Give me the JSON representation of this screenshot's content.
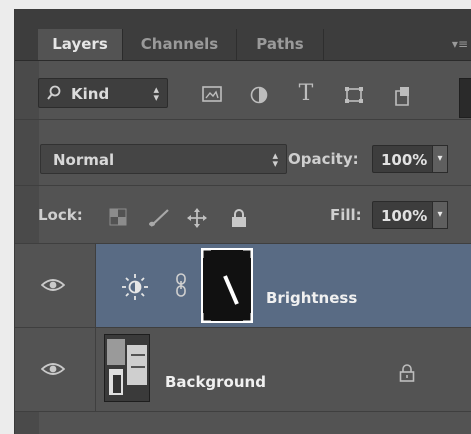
{
  "tabs": [
    {
      "label": "Layers",
      "active": true
    },
    {
      "label": "Channels",
      "active": false
    },
    {
      "label": "Paths",
      "active": false
    }
  ],
  "filter": {
    "kind_label": "Kind",
    "icons": [
      "image-filter-icon",
      "adjustment-filter-icon",
      "type-filter-icon",
      "shape-filter-icon",
      "smart-object-filter-icon"
    ]
  },
  "blend": {
    "mode": "Normal",
    "opacity_label": "Opacity:",
    "opacity_value": "100%"
  },
  "lock": {
    "label": "Lock:",
    "icons": [
      "lock-transparent-pixels-icon",
      "lock-image-pixels-icon",
      "lock-position-icon",
      "lock-all-icon"
    ],
    "fill_label": "Fill:",
    "fill_value": "100%"
  },
  "layers": [
    {
      "name": "Brightness",
      "type": "adjustment",
      "selected": true,
      "visible": true
    },
    {
      "name": "Background",
      "type": "image",
      "selected": false,
      "visible": true,
      "locked": true
    }
  ],
  "colors": {
    "panel": "#535353",
    "selected_row": "#596b84",
    "tab_bar": "#3d3d3d"
  }
}
